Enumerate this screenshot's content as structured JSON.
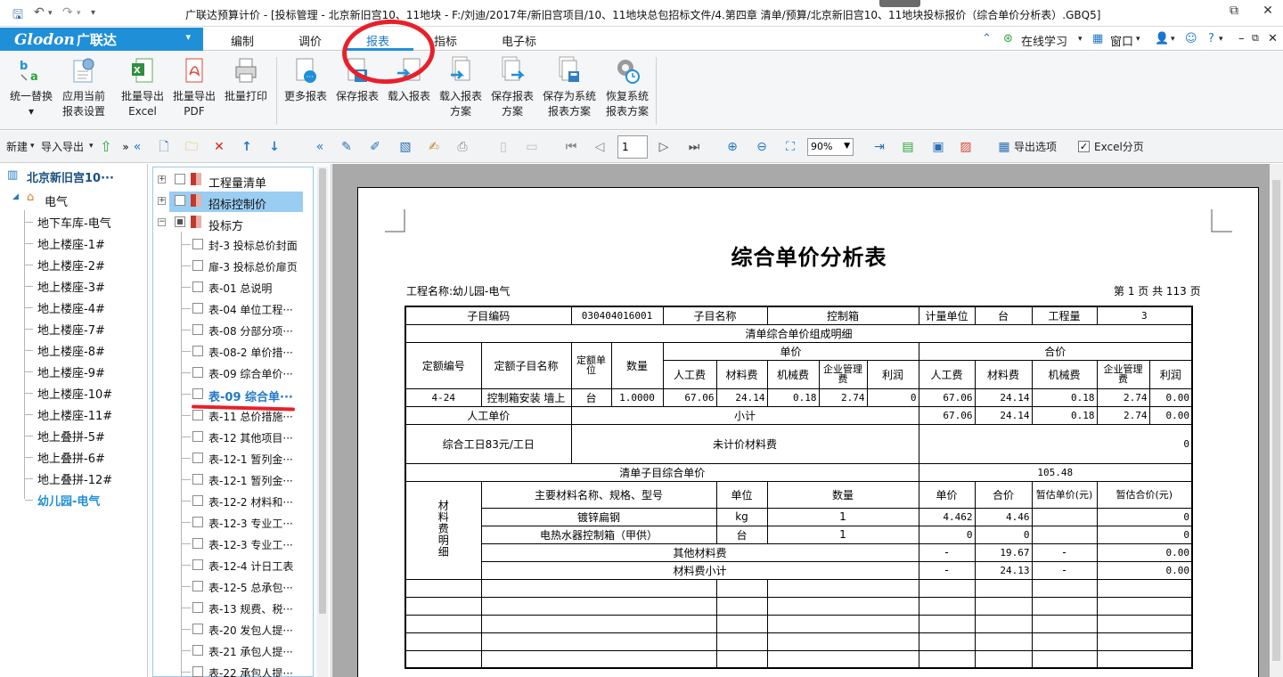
{
  "titlebar": {
    "title": "广联达预算计价 - [投标管理 - 北京新旧宫10、11地块 - F:/刘迪/2017年/新旧宫项目/10、11地块总包招标文件/4.第四章 清单/预算/北京新旧宫10、11地块投标报价（综合单价分析表）.GBQ5]",
    "quick_icons": [
      "save-icon",
      "undo-icon",
      "redo-icon",
      "customize-icon"
    ]
  },
  "menubar": {
    "brand": "Glodon",
    "brand_cn": "广联达",
    "tabs": [
      "编制",
      "调价",
      "报表",
      "指标",
      "电子标"
    ],
    "active_tab": "报表",
    "online_learning": "在线学习",
    "window": "窗口",
    "help": "?"
  },
  "ribbon": {
    "buttons": [
      {
        "label": "统一替换",
        "sub": "▾"
      },
      {
        "label": "应用当前",
        "sub": "报表设置"
      },
      {
        "label": "批量导出",
        "sub": "Excel"
      },
      {
        "label": "批量导出",
        "sub": "PDF"
      },
      {
        "label": "批量打印",
        "sub": ""
      },
      {
        "label": "更多报表",
        "sub": ""
      },
      {
        "label": "保存报表",
        "sub": ""
      },
      {
        "label": "载入报表",
        "sub": ""
      },
      {
        "label": "载入报表",
        "sub": "方案"
      },
      {
        "label": "保存报表",
        "sub": "方案"
      },
      {
        "label": "保存为系统",
        "sub": "报表方案"
      },
      {
        "label": "恢复系统",
        "sub": "报表方案"
      }
    ]
  },
  "toolbar": {
    "new": "新建",
    "import_export": "导入导出",
    "page_value": "1",
    "zoom": "90%",
    "export_options": "导出选项",
    "excel_split": "Excel分页"
  },
  "tree": {
    "root": "北京新旧宫10···",
    "group": "电气",
    "items": [
      "地下车库-电气",
      "地上楼座-1#",
      "地上楼座-2#",
      "地上楼座-3#",
      "地上楼座-4#",
      "地上楼座-7#",
      "地上楼座-8#",
      "地上楼座-9#",
      "地上楼座-10#",
      "地上楼座-11#",
      "地上叠拼-5#",
      "地上叠拼-6#",
      "地上叠拼-12#",
      "幼儿园-电气"
    ],
    "selected": "幼儿园-电气"
  },
  "report_list": {
    "groups": [
      "工程量清单",
      "招标控制价",
      "投标方"
    ],
    "items": [
      "封-3 投标总价封面",
      "扉-3 投标总价扉页",
      "表-01 总说明",
      "表-04 单位工程···",
      "表-08 分部分项···",
      "表-08-2 单价措···",
      "表-09 综合单价···",
      "表-09 综合单···",
      "表-11 总价措施···",
      "表-12 其他项目···",
      "表-12-1 暂列金···",
      "表-12-1 暂列金···",
      "表-12-2 材料和···",
      "表-12-3 专业工···",
      "表-12-3 专业工···",
      "表-12-4 计日工表",
      "表-12-5 总承包···",
      "表-13 规费、税···",
      "表-20 发包人提···",
      "表-21 承包人提···",
      "表-22 承包人提···"
    ],
    "selected_index": 7
  },
  "report": {
    "title": "综合单价分析表",
    "project_label": "工程名称:",
    "project_name": "幼儿园-电气",
    "page_info": "第 1 页   共 113 页",
    "row1": {
      "code_label": "子目编码",
      "code": "030404016001",
      "name_label": "子目名称",
      "name": "控制箱",
      "unit_label": "计量单位",
      "unit": "台",
      "qty_label": "工程量",
      "qty": "3"
    },
    "section_title": "清单综合单价组成明细",
    "headers": {
      "quota_code": "定额编号",
      "quota_name": "定额子目名称",
      "quota_unit": "定额单位",
      "quantity": "数量",
      "unit_price": "单价",
      "total_price": "合价",
      "labor": "人工费",
      "material": "材料费",
      "machine": "机械费",
      "mgmt": "企业管理费",
      "profit": "利润"
    },
    "detail_row": {
      "code": "4-24",
      "name": "控制箱安装 墙上",
      "unit": "台",
      "qty": "1.0000",
      "u_labor": "67.06",
      "u_material": "24.14",
      "u_machine": "0.18",
      "u_mgmt": "2.74",
      "u_profit": "0",
      "t_labor": "67.06",
      "t_material": "24.14",
      "t_machine": "0.18",
      "t_mgmt": "2.74",
      "t_profit": "0.00"
    },
    "labor_price_label": "人工单价",
    "subtotal_label": "小计",
    "subtotal": {
      "labor": "67.06",
      "material": "24.14",
      "machine": "0.18",
      "mgmt": "2.74",
      "profit": "0.00"
    },
    "labor_rate": "综合工日83元/工日",
    "unpriced_label": "未计价材料费",
    "unpriced_value": "0",
    "composite_label": "清单子目综合单价",
    "composite_value": "105.48",
    "material_section_label": "材料费明细",
    "mat_headers": {
      "name": "主要材料名称、规格、型号",
      "unit": "单位",
      "qty": "数量",
      "price": "单价",
      "total": "合价",
      "est_price": "暂估单价(元)",
      "est_total": "暂估合价(元)"
    },
    "materials": [
      {
        "name": "镀锌扁钢",
        "unit": "kg",
        "qty": "1",
        "price": "4.462",
        "total": "4.46",
        "est_price": "",
        "est_total": "0"
      },
      {
        "name": "电热水器控制箱（甲供）",
        "unit": "台",
        "qty": "1",
        "price": "0",
        "total": "0",
        "est_price": "",
        "est_total": "0"
      }
    ],
    "other_material": {
      "label": "其他材料费",
      "price": "-",
      "total": "19.67",
      "est_price": "-",
      "est_total": "0.00"
    },
    "material_subtotal": {
      "label": "材料费小计",
      "price": "-",
      "total": "24.13",
      "est_price": "-",
      "est_total": "0.00"
    }
  },
  "colors": {
    "brand_blue": "#1f8fd8",
    "annotation_red": "#e8202a",
    "selected_blue": "#1f78c8"
  }
}
